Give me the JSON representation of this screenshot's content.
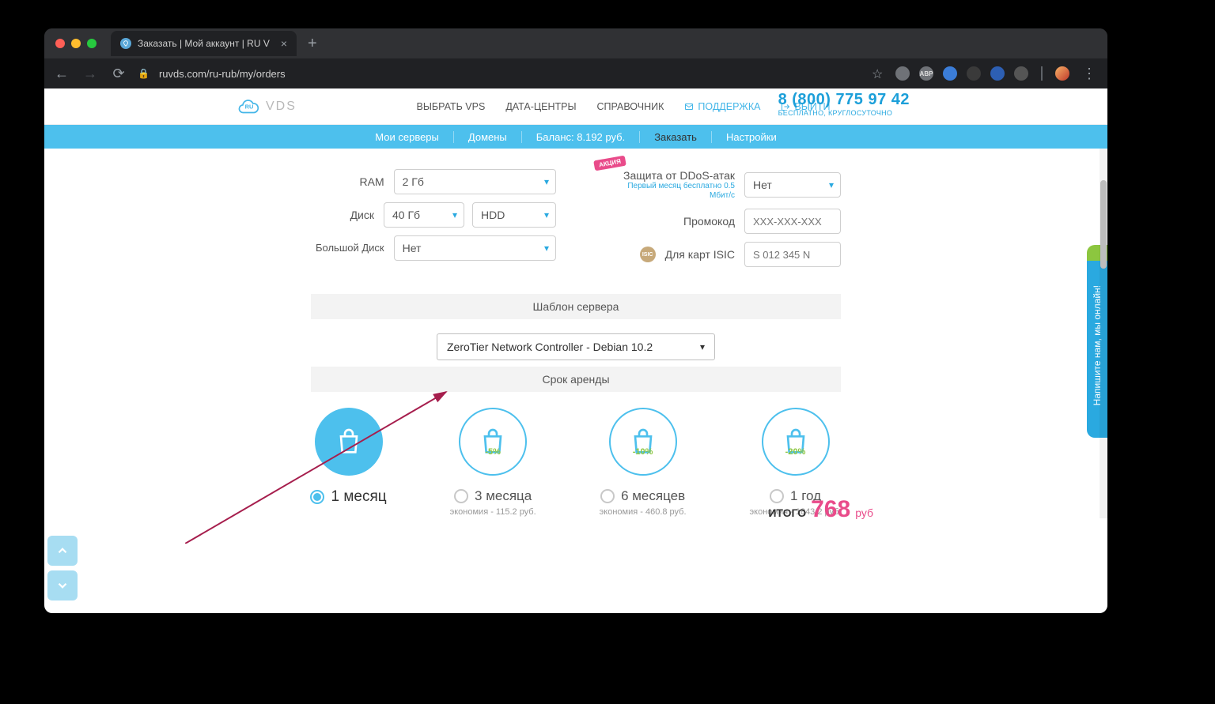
{
  "browser": {
    "tab_title": "Заказать | Мой аккаунт | RU V",
    "url": "ruvds.com/ru-rub/my/orders"
  },
  "logo_text": "VDS",
  "header": {
    "nav": [
      "ВЫБРАТЬ VPS",
      "ДАТА-ЦЕНТРЫ",
      "СПРАВОЧНИК"
    ],
    "support": "ПОДДЕРЖКА",
    "exit": "ВЫЙТИ",
    "phone": "8 (800) 775 97 42",
    "phone_sub": "БЕСПЛАТНО, КРУГЛОСУТОЧНО"
  },
  "subnav": {
    "servers": "Мои серверы",
    "domains": "Домены",
    "balance": "Баланс: 8.192 руб.",
    "order": "Заказать",
    "settings": "Настройки"
  },
  "config": {
    "ram_label": "RAM",
    "ram_value": "2 Гб",
    "disk_label": "Диск",
    "disk_size": "40 Гб",
    "disk_type": "HDD",
    "bigdisk_label": "Большой Диск",
    "bigdisk_value": "Нет",
    "akcia": "АКЦИЯ",
    "ddos_label": "Защита от DDoS-атак",
    "ddos_sub": "Первый месяц бесплатно 0.5 Мбит/с",
    "ddos_value": "Нет",
    "promo_label": "Промокод",
    "promo_placeholder": "XXX-XXX-XXX",
    "isic_label": "Для карт ISIC",
    "isic_placeholder": "S 012 345 N"
  },
  "template": {
    "header": "Шаблон сервера",
    "value": "ZeroTier Network Controller - Debian 10.2"
  },
  "rental": {
    "header": "Срок аренды",
    "periods": [
      {
        "label": "1 месяц",
        "discount": "",
        "savings": "",
        "selected": true
      },
      {
        "label": "3 месяца",
        "discount": "-5%",
        "savings": "экономия - 115.2 руб.",
        "selected": false
      },
      {
        "label": "6 месяцев",
        "discount": "-10%",
        "savings": "экономия - 460.8 руб.",
        "selected": false
      },
      {
        "label": "1 год",
        "discount": "-20%",
        "savings": "экономия - 1843.2 руб.",
        "selected": false
      }
    ]
  },
  "total": {
    "label": "ИТОГО",
    "price": "768",
    "unit": "руб"
  },
  "chat": "Напишите нам, мы онлайн!"
}
